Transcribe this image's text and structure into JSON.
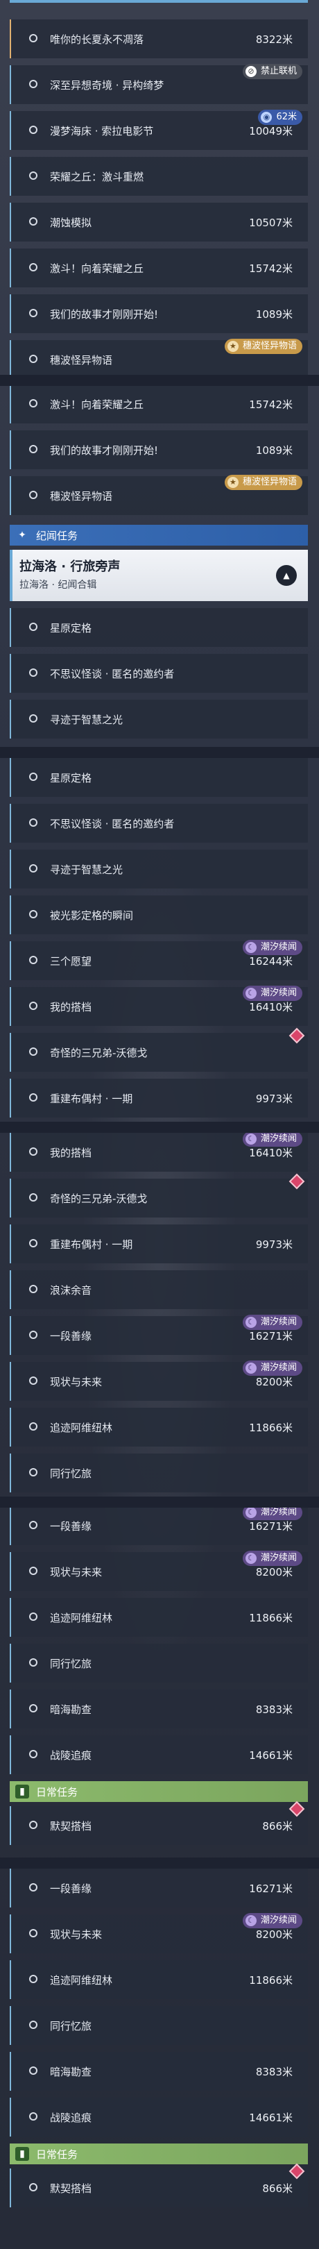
{
  "s1": [
    {
      "label": "唯你的长夏永不凋落",
      "dist": "8322米"
    },
    {
      "label": "深至异想奇境 · 异构绮梦",
      "dist": "",
      "badge": {
        "text": "禁止联机",
        "style": "gray",
        "icon": "slash-icon"
      }
    },
    {
      "label": "漫梦海床 · 索拉电影节",
      "dist": "10049米",
      "badge": {
        "text": "62米",
        "style": "blue",
        "icon": "eye-icon"
      }
    },
    {
      "label": "荣耀之丘：激斗重燃",
      "dist": ""
    },
    {
      "label": "潮蚀模拟",
      "dist": "10507米"
    },
    {
      "label": "激斗！向着荣耀之丘",
      "dist": "15742米"
    },
    {
      "label": "我们的故事才刚刚开始!",
      "dist": "1089米"
    },
    {
      "label": "穗波怪异物语",
      "dist": "",
      "badge": {
        "text": "穗波怪异物语",
        "style": "yellow",
        "icon": "star-icon"
      }
    }
  ],
  "s2": [
    {
      "label": "激斗！向着荣耀之丘",
      "dist": "15742米"
    },
    {
      "label": "我们的故事才刚刚开始!",
      "dist": "1089米"
    },
    {
      "label": "穗波怪异物语",
      "dist": "",
      "badge": {
        "text": "穗波怪异物语",
        "style": "yellow",
        "icon": "star-icon"
      }
    }
  ],
  "ji_header": "纪闻任务",
  "ji_quest": {
    "title": "拉海洛 · 行旅旁声",
    "sub": "拉海洛 · 纪闻合辑"
  },
  "ji_items": [
    "星原定格",
    "不思议怪谈 · 匿名的邀约者",
    "寻迹于智慧之光"
  ],
  "s3": [
    {
      "label": "星原定格",
      "dist": ""
    },
    {
      "label": "不思议怪谈 · 匿名的邀约者",
      "dist": ""
    },
    {
      "label": "寻迹于智慧之光",
      "dist": ""
    },
    {
      "label": "被光影定格的瞬间",
      "dist": ""
    },
    {
      "label": "三个愿望",
      "dist": "16244米",
      "badge": {
        "text": "潮汐续闻",
        "style": "purple",
        "icon": "moon-icon"
      }
    },
    {
      "label": "我的搭档",
      "dist": "16410米",
      "badge": {
        "text": "潮汐续闻",
        "style": "purple",
        "icon": "moon-icon"
      }
    },
    {
      "label": "奇怪的三兄弟-沃德戈",
      "dist": "",
      "diamond": true
    },
    {
      "label": "重建布偶村 · 一期",
      "dist": "9973米"
    }
  ],
  "s4": [
    {
      "label": "我的搭档",
      "dist": "16410米",
      "badge": {
        "text": "潮汐续闻",
        "style": "purple",
        "icon": "moon-icon"
      }
    },
    {
      "label": "奇怪的三兄弟-沃德戈",
      "dist": "",
      "diamond": true
    },
    {
      "label": "重建布偶村 · 一期",
      "dist": "9973米"
    },
    {
      "label": "浪沫余音",
      "dist": ""
    },
    {
      "label": "一段善缘",
      "dist": "16271米",
      "badge": {
        "text": "潮汐续闻",
        "style": "purple",
        "icon": "moon-icon"
      }
    },
    {
      "label": "现状与未来",
      "dist": "8200米",
      "badge": {
        "text": "潮汐续闻",
        "style": "purple",
        "icon": "moon-icon"
      }
    },
    {
      "label": "追迹阿维纽林",
      "dist": "11866米"
    },
    {
      "label": "同行忆旅",
      "dist": ""
    }
  ],
  "s5": [
    {
      "label": "一段善缘",
      "dist": "16271米",
      "badge": {
        "text": "潮汐续闻",
        "style": "purple",
        "icon": "moon-icon"
      }
    },
    {
      "label": "现状与未来",
      "dist": "8200米",
      "badge": {
        "text": "潮汐续闻",
        "style": "purple",
        "icon": "moon-icon"
      }
    },
    {
      "label": "追迹阿维纽林",
      "dist": "11866米"
    },
    {
      "label": "同行忆旅",
      "dist": ""
    },
    {
      "label": "暗海勘查",
      "dist": "8383米"
    },
    {
      "label": "战陵追痕",
      "dist": "14661米"
    }
  ],
  "daily_header": "日常任务",
  "daily1": {
    "label": "默契搭档",
    "dist": "866米",
    "diamond": true
  },
  "s6": [
    {
      "label": "一段善缘",
      "dist": "16271米"
    },
    {
      "label": "现状与未来",
      "dist": "8200米",
      "badge": {
        "text": "潮汐续闻",
        "style": "purple",
        "icon": "moon-icon"
      }
    },
    {
      "label": "追迹阿维纽林",
      "dist": "11866米"
    },
    {
      "label": "同行忆旅",
      "dist": ""
    },
    {
      "label": "暗海勘查",
      "dist": "8383米"
    },
    {
      "label": "战陵追痕",
      "dist": "14661米"
    }
  ],
  "daily2": {
    "label": "默契搭档",
    "dist": "866米",
    "diamond": true
  }
}
